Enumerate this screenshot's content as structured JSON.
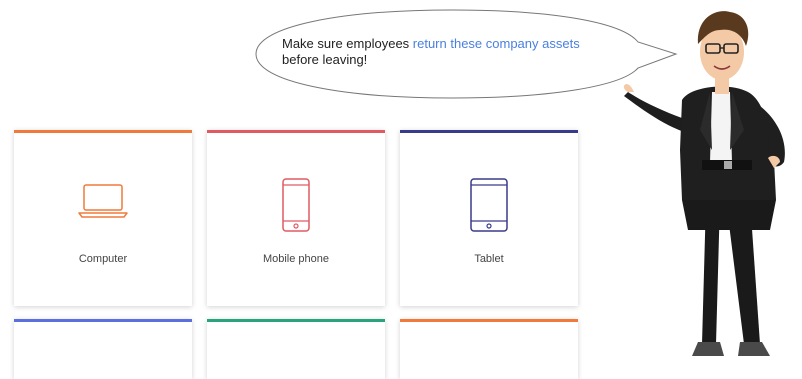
{
  "bubble": {
    "text_before": "Make sure employees ",
    "text_highlight": "return these company assets",
    "text_after": "before leaving!"
  },
  "cards": [
    {
      "label": "Computer",
      "accent": "#f07a3c",
      "icon": "laptop-icon"
    },
    {
      "label": "Mobile phone",
      "accent": "#e05a64",
      "icon": "mobile-phone-icon"
    },
    {
      "label": "Tablet",
      "accent": "#3a3a8c",
      "icon": "tablet-icon"
    },
    {
      "label": "",
      "accent": "#5b6fe0"
    },
    {
      "label": "",
      "accent": "#2aa37f"
    },
    {
      "label": "",
      "accent": "#f07a3c"
    }
  ],
  "colors": {
    "highlight": "#4a7fe0",
    "computer_icon": "#f07a3c",
    "phone_icon": "#e05a64",
    "tablet_icon": "#3a3a8c"
  }
}
